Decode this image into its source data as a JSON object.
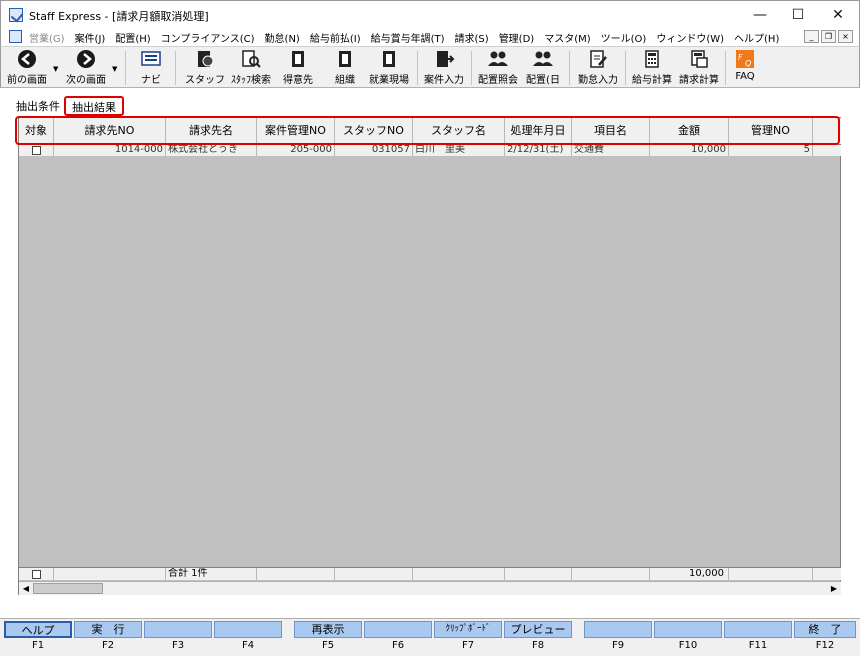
{
  "window": {
    "title": "Staff Express - [請求月額取消処理]",
    "controls": {
      "minimize": "—",
      "maximize": "☐",
      "close": "✕"
    }
  },
  "menubar": {
    "items": [
      {
        "label": "営業(G)",
        "disabled": true
      },
      {
        "label": "案件(J)"
      },
      {
        "label": "配置(H)"
      },
      {
        "label": "コンプライアンス(C)"
      },
      {
        "label": "勤怠(N)"
      },
      {
        "label": "給与前払(I)"
      },
      {
        "label": "給与賞与年調(T)"
      },
      {
        "label": "請求(S)"
      },
      {
        "label": "管理(D)"
      },
      {
        "label": "マスタ(M)"
      },
      {
        "label": "ツール(O)"
      },
      {
        "label": "ウィンドウ(W)"
      },
      {
        "label": "ヘルプ(H)"
      }
    ],
    "mdi": {
      "minimize": "_",
      "restore": "❐",
      "close": "×"
    }
  },
  "toolbar": {
    "prev_screen": "前の画面",
    "next_screen": "次の画面",
    "navi": "ナビ",
    "staff": "スタッフ",
    "staff_search": "ｽﾀｯﾌ検索",
    "client": "得意先",
    "organization": "組織",
    "worksite": "就業現場",
    "case_entry": "案件入力",
    "assignment_inquiry": "配置照会",
    "assignment_day": "配置(日",
    "attendance_entry": "勤怠入力",
    "payroll_calc": "給与計算",
    "billing_calc": "請求計算",
    "faq": "FAQ"
  },
  "tabs": [
    {
      "label": "抽出条件",
      "active": false
    },
    {
      "label": "抽出結果",
      "active": true
    }
  ],
  "grid": {
    "columns": [
      "対象",
      "請求先NO",
      "請求先名",
      "案件管理NO",
      "スタッフNO",
      "スタッフ名",
      "処理年月日",
      "項目名",
      "金額",
      "管理NO"
    ],
    "rows": [
      {
        "checked": false,
        "billing_no": "1014-000",
        "billing_name": "株式会社とうき",
        "case_no": "205-000",
        "staff_no": "031057",
        "staff_name": "白川　里美",
        "date": "2/12/31(土)",
        "item": "交通費",
        "amount": "10,000",
        "mgmt_no": "5"
      }
    ],
    "footer": {
      "total_label": "合計 1件",
      "total_amount": "10,000"
    }
  },
  "fkeys": [
    {
      "label": "ヘルプ",
      "key": "F1"
    },
    {
      "label": "実　行",
      "key": "F2"
    },
    {
      "label": "",
      "key": "F3"
    },
    {
      "label": "",
      "key": "F4"
    },
    {
      "label": "再表示",
      "key": "F5"
    },
    {
      "label": "",
      "key": "F6"
    },
    {
      "label": "ｸﾘｯﾌﾟﾎﾞｰﾄﾞ",
      "key": "F7"
    },
    {
      "label": "プレビュー",
      "key": "F8"
    },
    {
      "label": "",
      "key": "F9"
    },
    {
      "label": "",
      "key": "F10"
    },
    {
      "label": "",
      "key": "F11"
    },
    {
      "label": "終　了",
      "key": "F12"
    }
  ]
}
